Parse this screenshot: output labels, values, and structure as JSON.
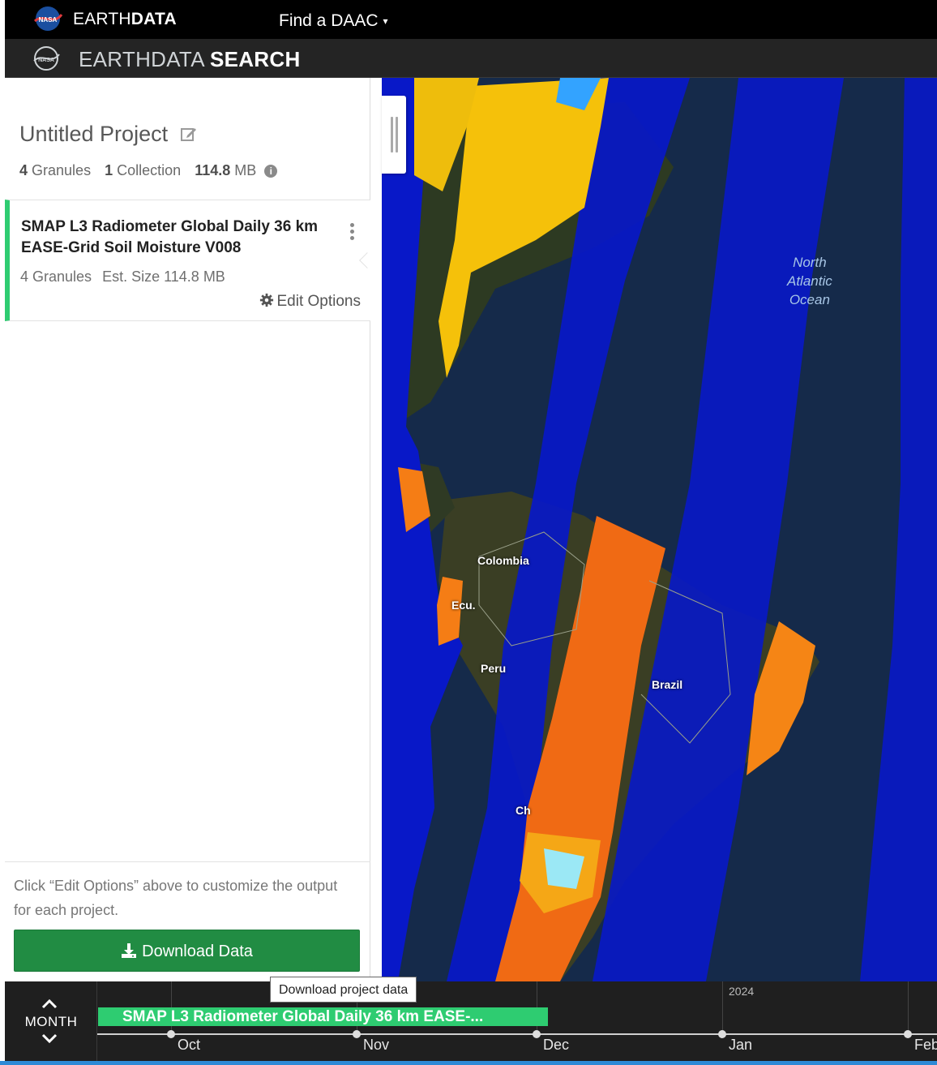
{
  "header": {
    "brand_prefix": "EARTH",
    "brand_suffix": "DATA",
    "find_daac": "Find a DAAC",
    "find_daac_caret": "▾"
  },
  "searchbar": {
    "title_prefix": "EARTHDATA",
    "title_suffix": "SEARCH"
  },
  "project": {
    "title": "Untitled Project",
    "granules_count": "4",
    "granules_label": "Granules",
    "collections_count": "1",
    "collections_label": "Collection",
    "size_value": "114.8",
    "size_unit": "MB",
    "info_glyph": "i"
  },
  "collection": {
    "title": "SMAP L3 Radiometer Global Daily 36 km EASE-Grid Soil Moisture V008",
    "granules": "4 Granules",
    "est_size": "Est. Size 114.8 MB",
    "edit_options": "Edit Options",
    "accent_color": "#2ecc71"
  },
  "footer": {
    "note": "Click “Edit Options” above to customize the output for each project.",
    "download_label": "Download Data",
    "tooltip": "Download project data"
  },
  "map": {
    "labels": {
      "colombia": "Colombia",
      "ecuador": "Ecu.",
      "peru": "Peru",
      "brazil": "Brazil",
      "chile": "Ch"
    },
    "ocean": [
      "North",
      "Atlantic",
      "Ocean"
    ]
  },
  "timeline": {
    "zoom_label": "MONTH",
    "year_label": "2024",
    "months": [
      "Oct",
      "Nov",
      "Dec",
      "Jan",
      "Feb"
    ],
    "bar_label": "SMAP L3 Radiometer Global Daily 36 km EASE-...",
    "bar_color": "#2ecc71"
  },
  "icons": [
    "nasa-logo",
    "edit-icon",
    "info-icon",
    "kebab-icon",
    "gear-icon",
    "download-icon",
    "chevron-up-icon",
    "chevron-down-icon"
  ]
}
